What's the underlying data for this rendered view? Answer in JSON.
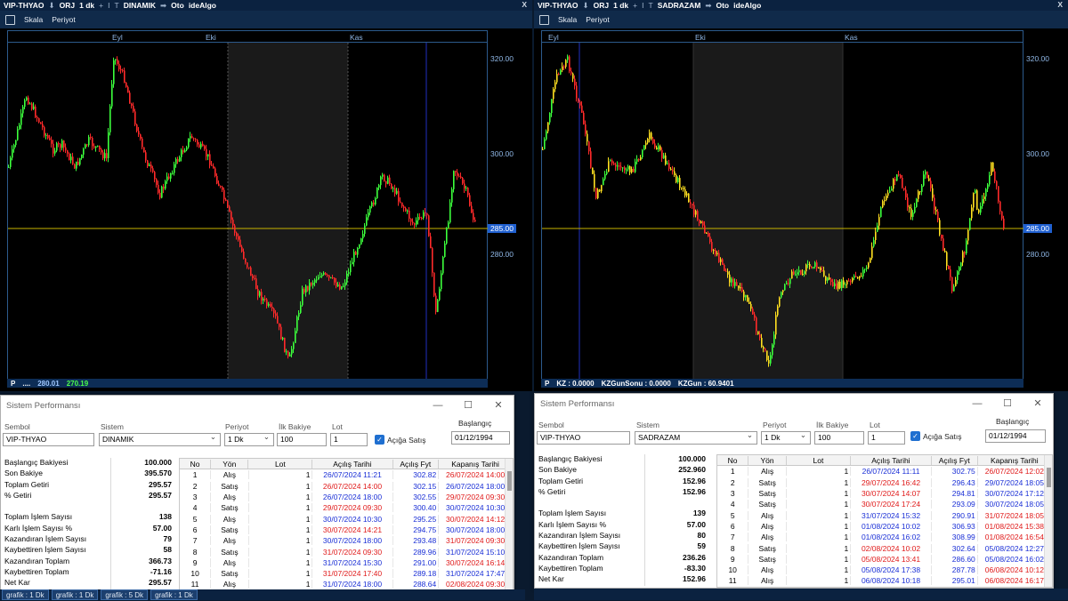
{
  "left": {
    "toolbar": [
      "VIP-THYAO",
      "ORJ",
      "1 dk",
      "DINAMIK",
      "Oto",
      "ideAlgo"
    ],
    "menu": [
      "Skala",
      "Periyot"
    ],
    "months": [
      "Eyl",
      "Eki",
      "Kas"
    ],
    "y_ticks": [
      "320.00",
      "300.00",
      "280.00"
    ],
    "y_current": "285.00",
    "status": {
      "p": "P",
      "dots": "....",
      "v1": "280.01",
      "v2": "270.19"
    },
    "win": {
      "title": "Sistem Performansı",
      "labels": {
        "sembol": "Sembol",
        "sistem": "Sistem",
        "periyot": "Periyot",
        "bakiye": "İlk Bakiye",
        "lot": "Lot",
        "baslangic": "Başlangıç",
        "aciga": "Açığa Satış"
      },
      "values": {
        "sembol": "VIP-THYAO",
        "sistem": "DINAMIK",
        "periyot": "1 Dk",
        "bakiye": "100",
        "lot": "1",
        "baslangic": "01/12/1994"
      },
      "stats": [
        [
          "Başlangıç Bakiyesi",
          "100.000"
        ],
        [
          "Son Bakiye",
          "395.570"
        ],
        [
          "Toplam Getiri",
          "295.57"
        ],
        [
          "% Getiri",
          "295.57"
        ],
        [
          "",
          ""
        ],
        [
          "Toplam İşlem Sayısı",
          "138"
        ],
        [
          "Karlı İşlem Sayısı %",
          "57.00"
        ],
        [
          "Kazandıran İşlem Sayısı",
          "79"
        ],
        [
          "Kaybettiren İşlem Sayısı",
          "58"
        ],
        [
          "Kazandıran Toplam",
          "366.73"
        ],
        [
          "Kaybettiren Toplam",
          "-71.16"
        ],
        [
          "Net Kar",
          "295.57"
        ]
      ],
      "cols": [
        "No",
        "Yön",
        "Lot",
        "Açılış Tarihi",
        "Açılış Fyt",
        "Kapanış Tarihi"
      ],
      "rows": [
        [
          "1",
          "Alış",
          "1",
          "26/07/2024 11:21",
          "302.82",
          "26/07/2024 14:00"
        ],
        [
          "2",
          "Satış",
          "1",
          "26/07/2024 14:00",
          "302.15",
          "26/07/2024 18:00"
        ],
        [
          "3",
          "Alış",
          "1",
          "26/07/2024 18:00",
          "302.55",
          "29/07/2024 09:30"
        ],
        [
          "4",
          "Satış",
          "1",
          "29/07/2024 09:30",
          "300.40",
          "30/07/2024 10:30"
        ],
        [
          "5",
          "Alış",
          "1",
          "30/07/2024 10:30",
          "295.25",
          "30/07/2024 14:12"
        ],
        [
          "6",
          "Satış",
          "1",
          "30/07/2024 14:21",
          "294.75",
          "30/07/2024 18:00"
        ],
        [
          "7",
          "Alış",
          "1",
          "30/07/2024 18:00",
          "293.48",
          "31/07/2024 09:30"
        ],
        [
          "8",
          "Satış",
          "1",
          "31/07/2024 09:30",
          "289.96",
          "31/07/2024 15:10"
        ],
        [
          "9",
          "Alış",
          "1",
          "31/07/2024 15:30",
          "291.00",
          "30/07/2024 16:14"
        ],
        [
          "10",
          "Satış",
          "1",
          "31/07/2024 17:40",
          "289.18",
          "31/07/2024 17:47"
        ],
        [
          "11",
          "Alış",
          "1",
          "31/07/2024 18:00",
          "288.64",
          "02/08/2024 09:30"
        ]
      ]
    },
    "tabs": [
      "grafik : 1 Dk",
      "grafik : 1 Dk",
      "grafik : 5 Dk",
      "grafik : 1 Dk"
    ]
  },
  "right": {
    "toolbar": [
      "VIP-THYAO",
      "ORJ",
      "1 dk",
      "SADRAZAM",
      "Oto",
      "ideAlgo"
    ],
    "menu": [
      "Skala",
      "Periyot"
    ],
    "months": [
      "Eyl",
      "Eki",
      "Kas"
    ],
    "y_ticks": [
      "320.00",
      "300.00",
      "280.00"
    ],
    "y_current": "285.00",
    "status": {
      "p": "P",
      "kz": "KZ : 0.0000",
      "kzs": "KZGunSonu : 0.0000",
      "kzg": "KZGun : 60.9401"
    },
    "win": {
      "title": "Sistem Performansı",
      "labels": {
        "sembol": "Sembol",
        "sistem": "Sistem",
        "periyot": "Periyot",
        "bakiye": "İlk Bakiye",
        "lot": "Lot",
        "baslangic": "Başlangıç",
        "aciga": "Açığa Satış"
      },
      "values": {
        "sembol": "VIP-THYAO",
        "sistem": "SADRAZAM",
        "periyot": "1 Dk",
        "bakiye": "100",
        "lot": "1",
        "baslangic": "01/12/1994"
      },
      "stats": [
        [
          "Başlangıç Bakiyesi",
          "100.000"
        ],
        [
          "Son Bakiye",
          "252.960"
        ],
        [
          "Toplam Getiri",
          "152.96"
        ],
        [
          "% Getiri",
          "152.96"
        ],
        [
          "",
          ""
        ],
        [
          "Toplam İşlem Sayısı",
          "139"
        ],
        [
          "Karlı İşlem Sayısı %",
          "57.00"
        ],
        [
          "Kazandıran İşlem Sayısı",
          "80"
        ],
        [
          "Kaybettiren İşlem Sayısı",
          "59"
        ],
        [
          "Kazandıran Toplam",
          "236.26"
        ],
        [
          "Kaybettiren Toplam",
          "-83.30"
        ],
        [
          "Net Kar",
          "152.96"
        ]
      ],
      "cols": [
        "No",
        "Yön",
        "Lot",
        "Açılış Tarihi",
        "Açılış Fyt",
        "Kapanış Tarihi"
      ],
      "rows": [
        [
          "1",
          "Alış",
          "1",
          "26/07/2024 11:11",
          "302.75",
          "26/07/2024 12:02"
        ],
        [
          "2",
          "Satış",
          "1",
          "29/07/2024 16:42",
          "296.43",
          "29/07/2024 18:05"
        ],
        [
          "3",
          "Satış",
          "1",
          "30/07/2024 14:07",
          "294.81",
          "30/07/2024 17:12"
        ],
        [
          "4",
          "Satış",
          "1",
          "30/07/2024 17:24",
          "293.09",
          "30/07/2024 18:05"
        ],
        [
          "5",
          "Alış",
          "1",
          "31/07/2024 15:32",
          "290.91",
          "31/07/2024 18:05"
        ],
        [
          "6",
          "Alış",
          "1",
          "01/08/2024 10:02",
          "306.93",
          "01/08/2024 15:38"
        ],
        [
          "7",
          "Alış",
          "1",
          "01/08/2024 16:02",
          "308.99",
          "01/08/2024 16:54"
        ],
        [
          "8",
          "Satış",
          "1",
          "02/08/2024 10:02",
          "302.64",
          "05/08/2024 12:27"
        ],
        [
          "9",
          "Satış",
          "1",
          "05/08/2024 13:41",
          "286.60",
          "05/08/2024 16:02"
        ],
        [
          "10",
          "Alış",
          "1",
          "05/08/2024 17:38",
          "287.78",
          "06/08/2024 10:12"
        ],
        [
          "11",
          "Alış",
          "1",
          "06/08/2024 10:18",
          "295.01",
          "06/08/2024 16:17"
        ]
      ]
    }
  },
  "colors": {
    "up": "#3cff3c",
    "down": "#ff2a2a",
    "amber": "#ffe020",
    "level": "#c8b400",
    "buy_date": "#1a2fd6",
    "sell_date": "#e01a1a"
  }
}
